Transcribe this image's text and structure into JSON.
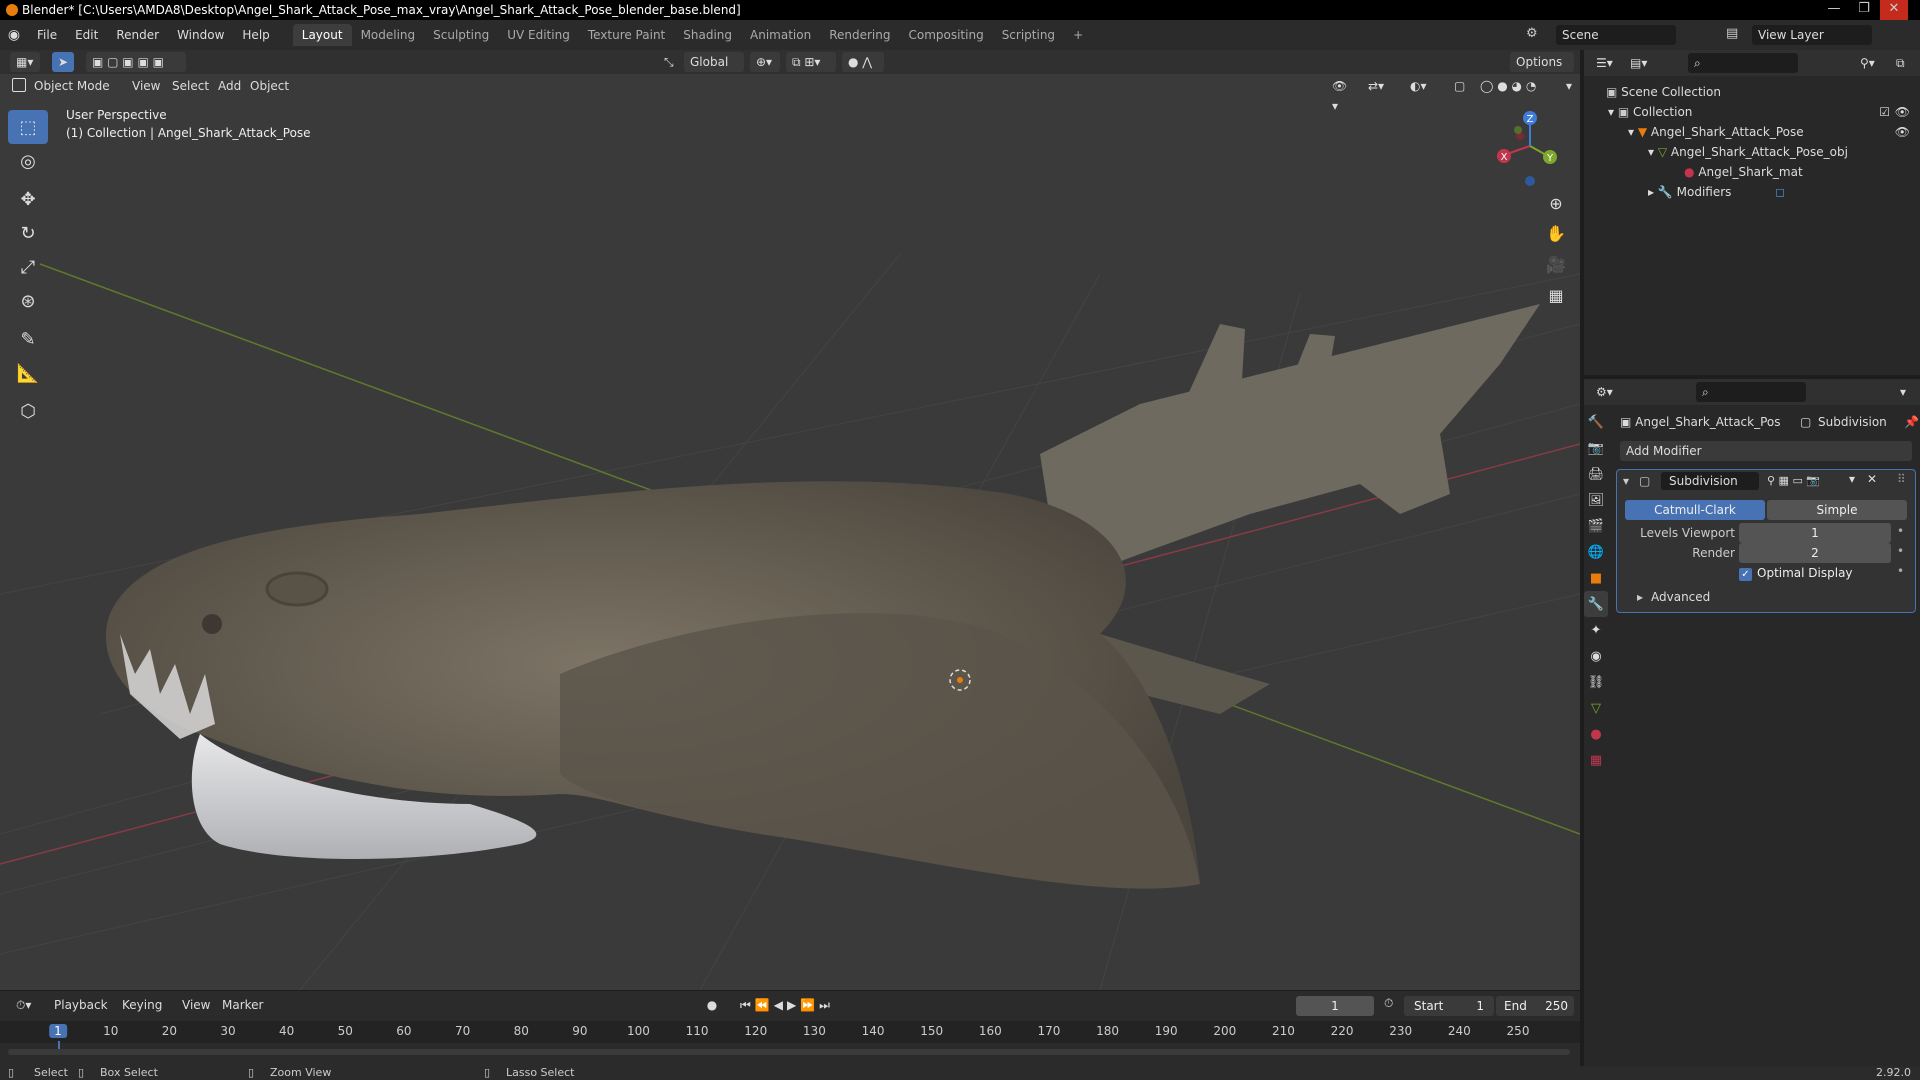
{
  "window": {
    "title": "Blender* [C:\\Users\\AMDA8\\Desktop\\Angel_Shark_Attack_Pose_max_vray\\Angel_Shark_Attack_Pose_blender_base.blend]",
    "controls": [
      "—",
      "❐",
      "✕"
    ]
  },
  "menubar": {
    "menus": [
      "File",
      "Edit",
      "Render",
      "Window",
      "Help"
    ],
    "workspaces": [
      "Layout",
      "Modeling",
      "Sculpting",
      "UV Editing",
      "Texture Paint",
      "Shading",
      "Animation",
      "Rendering",
      "Compositing",
      "Scripting"
    ],
    "active_workspace": "Layout",
    "add_tab": "+",
    "scene": "Scene",
    "view_layer": "View Layer"
  },
  "viewport_header": {
    "mode": "Object Mode",
    "menus": [
      "View",
      "Select",
      "Add",
      "Object"
    ],
    "orientation": "Global",
    "options": "Options"
  },
  "viewport": {
    "perspective": "User Perspective",
    "collection_info": "(1) Collection | Angel_Shark_Attack_Pose",
    "gizmo": {
      "x": "X",
      "y": "Y",
      "z": "Z"
    }
  },
  "outliner": {
    "scene_collection": "Scene Collection",
    "collection": "Collection",
    "object": "Angel_Shark_Attack_Pose",
    "mesh": "Angel_Shark_Attack_Pose_obj",
    "material": "Angel_Shark_mat",
    "modifiers": "Modifiers"
  },
  "properties": {
    "object_name": "Angel_Shark_Attack_Pos",
    "modifier_crumb": "Subdivision",
    "add_modifier": "Add Modifier",
    "modifier_name": "Subdivision",
    "catmull_clark": "Catmull-Clark",
    "simple": "Simple",
    "levels_viewport_label": "Levels Viewport",
    "levels_viewport_value": "1",
    "render_label": "Render",
    "render_value": "2",
    "optimal_display": "Optimal Display",
    "advanced": "Advanced"
  },
  "timeline": {
    "menus": [
      "Playback",
      "Keying",
      "View",
      "Marker"
    ],
    "current_frame": "1",
    "start_label": "Start",
    "start_value": "1",
    "end_label": "End",
    "end_value": "250",
    "ticks": [
      "1",
      "10",
      "20",
      "30",
      "40",
      "50",
      "60",
      "70",
      "80",
      "90",
      "100",
      "110",
      "120",
      "130",
      "140",
      "150",
      "160",
      "170",
      "180",
      "190",
      "200",
      "210",
      "220",
      "230",
      "240",
      "250"
    ]
  },
  "statusbar": {
    "select": "Select",
    "box_select": "Box Select",
    "zoom_view": "Zoom View",
    "lasso_select": "Lasso Select",
    "version": "2.92.0"
  },
  "colors": {
    "accent": "#4772b3",
    "active_frame": "#4772b3",
    "x_axis": "#c2364d",
    "y_axis": "#7ea72d",
    "z_axis": "#3f7ddb"
  }
}
